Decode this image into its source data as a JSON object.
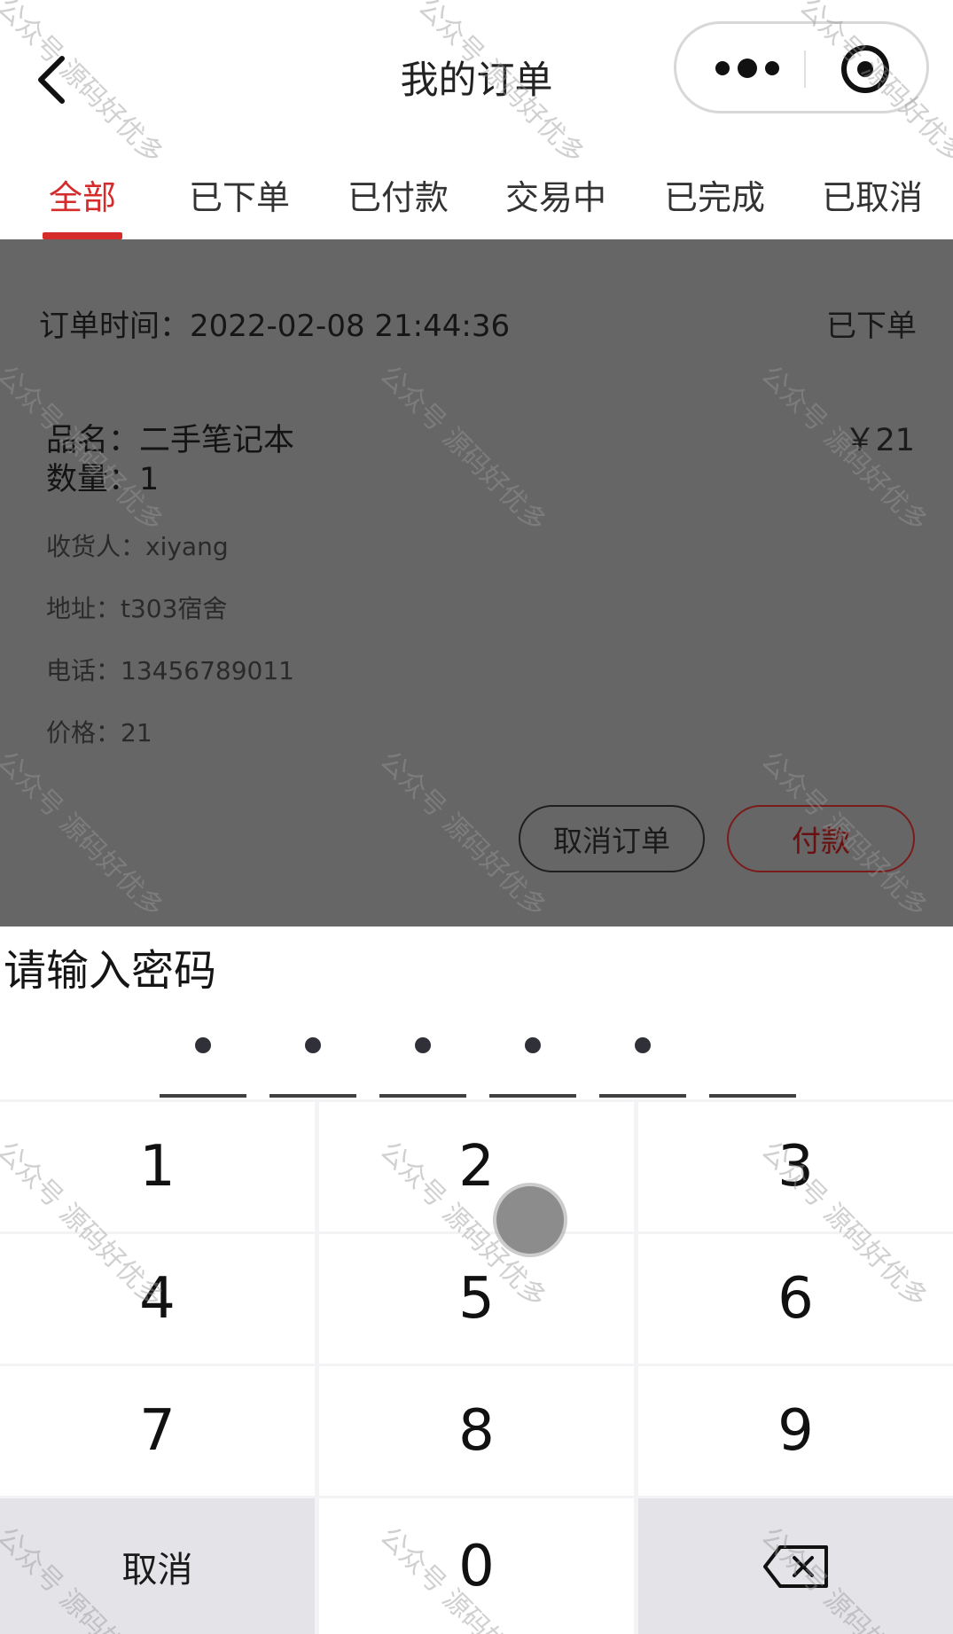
{
  "header": {
    "title": "我的订单",
    "back_icon": "chevron-left-icon",
    "more_icon": "more-dots-icon",
    "close_icon": "target-close-icon"
  },
  "tabs": [
    {
      "label": "全部",
      "active": true
    },
    {
      "label": "已下单",
      "active": false
    },
    {
      "label": "已付款",
      "active": false
    },
    {
      "label": "交易中",
      "active": false
    },
    {
      "label": "已完成",
      "active": false
    },
    {
      "label": "已取消",
      "active": false
    }
  ],
  "order": {
    "time_label": "订单时间：",
    "time_value": "2022-02-08 21:44:36",
    "status": "已下单",
    "name_line": "品名：二手笔记本",
    "quantity_line": "数量：1",
    "price_badge": "￥21",
    "receiver_line": "收货人：xiyang",
    "address_line": "地址：t303宿舍",
    "phone_line": "电话：13456789011",
    "price_line": "价格：21",
    "cancel_label": "取消订单",
    "pay_label": "付款"
  },
  "password": {
    "title": "请输入密码",
    "entered_count": 5,
    "total_count": 6
  },
  "keypad": {
    "keys": [
      "1",
      "2",
      "3",
      "4",
      "5",
      "6",
      "7",
      "8",
      "9"
    ],
    "cancel_label": "取消",
    "zero_label": "0",
    "delete_icon": "backspace-icon"
  },
  "watermark": "公众号 源码好优多",
  "colors": {
    "accent": "#d62b2b",
    "overlay": "#666666",
    "keypad_gray": "#e4e4e8"
  }
}
